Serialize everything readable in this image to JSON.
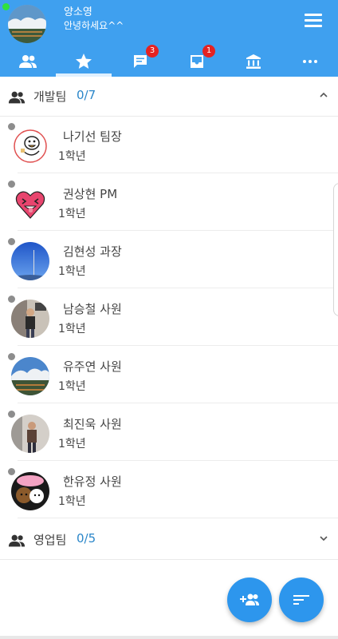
{
  "profile": {
    "name": "양소영",
    "status": "안녕하세요^^"
  },
  "tabs": [
    {
      "icon": "friends-icon"
    },
    {
      "icon": "star-icon",
      "active": true
    },
    {
      "icon": "chat-icon",
      "badge": "3"
    },
    {
      "icon": "inbox-icon",
      "badge": "1"
    },
    {
      "icon": "bank-icon"
    },
    {
      "icon": "more-icon"
    }
  ],
  "groups": [
    {
      "name": "개발팀",
      "count": "0/7",
      "expanded": true,
      "members": [
        {
          "name": "나기선 팀장",
          "grade": "1학년"
        },
        {
          "name": "권상현 PM",
          "grade": "1학년"
        },
        {
          "name": "김현성 과장",
          "grade": "1학년"
        },
        {
          "name": "남승철 사원",
          "grade": "1학년"
        },
        {
          "name": "유주연 사원",
          "grade": "1학년"
        },
        {
          "name": "최진욱 사원",
          "grade": "1학년"
        },
        {
          "name": "한유정 사원",
          "grade": "1학년"
        }
      ]
    },
    {
      "name": "영업팀",
      "count": "0/5",
      "expanded": false
    }
  ],
  "fabs": [
    {
      "icon": "add-friend-icon"
    },
    {
      "icon": "sort-icon"
    }
  ],
  "colors": {
    "header": "#3fa0ef",
    "accent": "#2a86c9",
    "badge": "#e52222",
    "fab": "#2d96ed",
    "online": "#30e040",
    "offline": "#8d8d8d"
  }
}
